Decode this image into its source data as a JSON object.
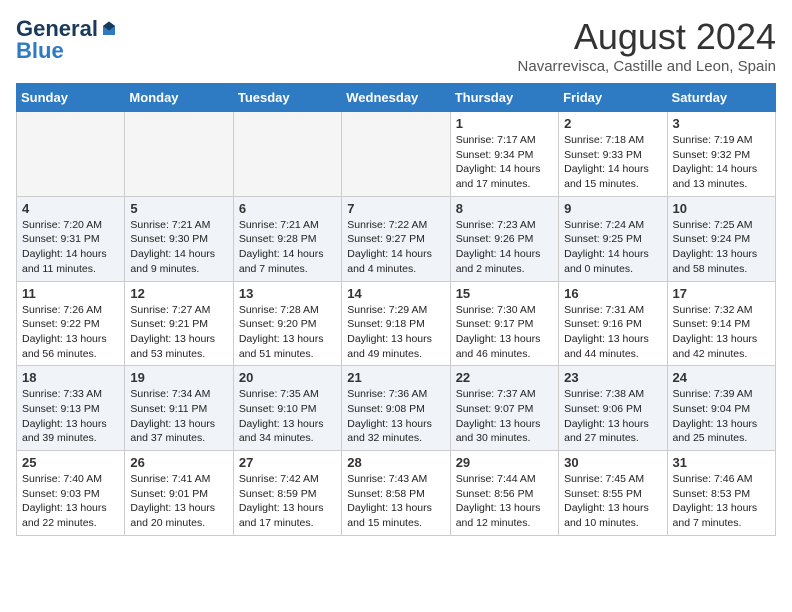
{
  "header": {
    "logo": {
      "general": "General",
      "blue": "Blue"
    },
    "title": "August 2024",
    "location": "Navarrevisca, Castille and Leon, Spain"
  },
  "calendar": {
    "weekdays": [
      "Sunday",
      "Monday",
      "Tuesday",
      "Wednesday",
      "Thursday",
      "Friday",
      "Saturday"
    ],
    "weeks": [
      [
        {
          "day": "",
          "info": ""
        },
        {
          "day": "",
          "info": ""
        },
        {
          "day": "",
          "info": ""
        },
        {
          "day": "",
          "info": ""
        },
        {
          "day": "1",
          "info": "Sunrise: 7:17 AM\nSunset: 9:34 PM\nDaylight: 14 hours\nand 17 minutes."
        },
        {
          "day": "2",
          "info": "Sunrise: 7:18 AM\nSunset: 9:33 PM\nDaylight: 14 hours\nand 15 minutes."
        },
        {
          "day": "3",
          "info": "Sunrise: 7:19 AM\nSunset: 9:32 PM\nDaylight: 14 hours\nand 13 minutes."
        }
      ],
      [
        {
          "day": "4",
          "info": "Sunrise: 7:20 AM\nSunset: 9:31 PM\nDaylight: 14 hours\nand 11 minutes."
        },
        {
          "day": "5",
          "info": "Sunrise: 7:21 AM\nSunset: 9:30 PM\nDaylight: 14 hours\nand 9 minutes."
        },
        {
          "day": "6",
          "info": "Sunrise: 7:21 AM\nSunset: 9:28 PM\nDaylight: 14 hours\nand 7 minutes."
        },
        {
          "day": "7",
          "info": "Sunrise: 7:22 AM\nSunset: 9:27 PM\nDaylight: 14 hours\nand 4 minutes."
        },
        {
          "day": "8",
          "info": "Sunrise: 7:23 AM\nSunset: 9:26 PM\nDaylight: 14 hours\nand 2 minutes."
        },
        {
          "day": "9",
          "info": "Sunrise: 7:24 AM\nSunset: 9:25 PM\nDaylight: 14 hours\nand 0 minutes."
        },
        {
          "day": "10",
          "info": "Sunrise: 7:25 AM\nSunset: 9:24 PM\nDaylight: 13 hours\nand 58 minutes."
        }
      ],
      [
        {
          "day": "11",
          "info": "Sunrise: 7:26 AM\nSunset: 9:22 PM\nDaylight: 13 hours\nand 56 minutes."
        },
        {
          "day": "12",
          "info": "Sunrise: 7:27 AM\nSunset: 9:21 PM\nDaylight: 13 hours\nand 53 minutes."
        },
        {
          "day": "13",
          "info": "Sunrise: 7:28 AM\nSunset: 9:20 PM\nDaylight: 13 hours\nand 51 minutes."
        },
        {
          "day": "14",
          "info": "Sunrise: 7:29 AM\nSunset: 9:18 PM\nDaylight: 13 hours\nand 49 minutes."
        },
        {
          "day": "15",
          "info": "Sunrise: 7:30 AM\nSunset: 9:17 PM\nDaylight: 13 hours\nand 46 minutes."
        },
        {
          "day": "16",
          "info": "Sunrise: 7:31 AM\nSunset: 9:16 PM\nDaylight: 13 hours\nand 44 minutes."
        },
        {
          "day": "17",
          "info": "Sunrise: 7:32 AM\nSunset: 9:14 PM\nDaylight: 13 hours\nand 42 minutes."
        }
      ],
      [
        {
          "day": "18",
          "info": "Sunrise: 7:33 AM\nSunset: 9:13 PM\nDaylight: 13 hours\nand 39 minutes."
        },
        {
          "day": "19",
          "info": "Sunrise: 7:34 AM\nSunset: 9:11 PM\nDaylight: 13 hours\nand 37 minutes."
        },
        {
          "day": "20",
          "info": "Sunrise: 7:35 AM\nSunset: 9:10 PM\nDaylight: 13 hours\nand 34 minutes."
        },
        {
          "day": "21",
          "info": "Sunrise: 7:36 AM\nSunset: 9:08 PM\nDaylight: 13 hours\nand 32 minutes."
        },
        {
          "day": "22",
          "info": "Sunrise: 7:37 AM\nSunset: 9:07 PM\nDaylight: 13 hours\nand 30 minutes."
        },
        {
          "day": "23",
          "info": "Sunrise: 7:38 AM\nSunset: 9:06 PM\nDaylight: 13 hours\nand 27 minutes."
        },
        {
          "day": "24",
          "info": "Sunrise: 7:39 AM\nSunset: 9:04 PM\nDaylight: 13 hours\nand 25 minutes."
        }
      ],
      [
        {
          "day": "25",
          "info": "Sunrise: 7:40 AM\nSunset: 9:03 PM\nDaylight: 13 hours\nand 22 minutes."
        },
        {
          "day": "26",
          "info": "Sunrise: 7:41 AM\nSunset: 9:01 PM\nDaylight: 13 hours\nand 20 minutes."
        },
        {
          "day": "27",
          "info": "Sunrise: 7:42 AM\nSunset: 8:59 PM\nDaylight: 13 hours\nand 17 minutes."
        },
        {
          "day": "28",
          "info": "Sunrise: 7:43 AM\nSunset: 8:58 PM\nDaylight: 13 hours\nand 15 minutes."
        },
        {
          "day": "29",
          "info": "Sunrise: 7:44 AM\nSunset: 8:56 PM\nDaylight: 13 hours\nand 12 minutes."
        },
        {
          "day": "30",
          "info": "Sunrise: 7:45 AM\nSunset: 8:55 PM\nDaylight: 13 hours\nand 10 minutes."
        },
        {
          "day": "31",
          "info": "Sunrise: 7:46 AM\nSunset: 8:53 PM\nDaylight: 13 hours\nand 7 minutes."
        }
      ]
    ]
  }
}
